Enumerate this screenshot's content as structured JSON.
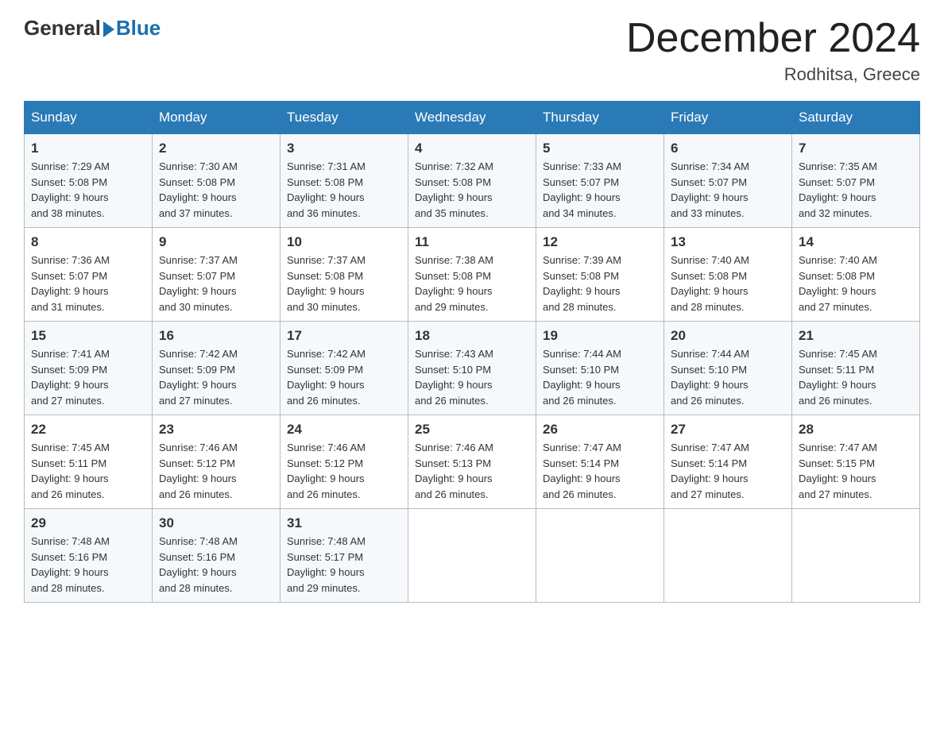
{
  "header": {
    "logo_general": "General",
    "logo_blue": "Blue",
    "title": "December 2024",
    "location": "Rodhitsa, Greece"
  },
  "days_of_week": [
    "Sunday",
    "Monday",
    "Tuesday",
    "Wednesday",
    "Thursday",
    "Friday",
    "Saturday"
  ],
  "weeks": [
    [
      {
        "day": "1",
        "sunrise": "7:29 AM",
        "sunset": "5:08 PM",
        "daylight": "9 hours and 38 minutes."
      },
      {
        "day": "2",
        "sunrise": "7:30 AM",
        "sunset": "5:08 PM",
        "daylight": "9 hours and 37 minutes."
      },
      {
        "day": "3",
        "sunrise": "7:31 AM",
        "sunset": "5:08 PM",
        "daylight": "9 hours and 36 minutes."
      },
      {
        "day": "4",
        "sunrise": "7:32 AM",
        "sunset": "5:08 PM",
        "daylight": "9 hours and 35 minutes."
      },
      {
        "day": "5",
        "sunrise": "7:33 AM",
        "sunset": "5:07 PM",
        "daylight": "9 hours and 34 minutes."
      },
      {
        "day": "6",
        "sunrise": "7:34 AM",
        "sunset": "5:07 PM",
        "daylight": "9 hours and 33 minutes."
      },
      {
        "day": "7",
        "sunrise": "7:35 AM",
        "sunset": "5:07 PM",
        "daylight": "9 hours and 32 minutes."
      }
    ],
    [
      {
        "day": "8",
        "sunrise": "7:36 AM",
        "sunset": "5:07 PM",
        "daylight": "9 hours and 31 minutes."
      },
      {
        "day": "9",
        "sunrise": "7:37 AM",
        "sunset": "5:07 PM",
        "daylight": "9 hours and 30 minutes."
      },
      {
        "day": "10",
        "sunrise": "7:37 AM",
        "sunset": "5:08 PM",
        "daylight": "9 hours and 30 minutes."
      },
      {
        "day": "11",
        "sunrise": "7:38 AM",
        "sunset": "5:08 PM",
        "daylight": "9 hours and 29 minutes."
      },
      {
        "day": "12",
        "sunrise": "7:39 AM",
        "sunset": "5:08 PM",
        "daylight": "9 hours and 28 minutes."
      },
      {
        "day": "13",
        "sunrise": "7:40 AM",
        "sunset": "5:08 PM",
        "daylight": "9 hours and 28 minutes."
      },
      {
        "day": "14",
        "sunrise": "7:40 AM",
        "sunset": "5:08 PM",
        "daylight": "9 hours and 27 minutes."
      }
    ],
    [
      {
        "day": "15",
        "sunrise": "7:41 AM",
        "sunset": "5:09 PM",
        "daylight": "9 hours and 27 minutes."
      },
      {
        "day": "16",
        "sunrise": "7:42 AM",
        "sunset": "5:09 PM",
        "daylight": "9 hours and 27 minutes."
      },
      {
        "day": "17",
        "sunrise": "7:42 AM",
        "sunset": "5:09 PM",
        "daylight": "9 hours and 26 minutes."
      },
      {
        "day": "18",
        "sunrise": "7:43 AM",
        "sunset": "5:10 PM",
        "daylight": "9 hours and 26 minutes."
      },
      {
        "day": "19",
        "sunrise": "7:44 AM",
        "sunset": "5:10 PM",
        "daylight": "9 hours and 26 minutes."
      },
      {
        "day": "20",
        "sunrise": "7:44 AM",
        "sunset": "5:10 PM",
        "daylight": "9 hours and 26 minutes."
      },
      {
        "day": "21",
        "sunrise": "7:45 AM",
        "sunset": "5:11 PM",
        "daylight": "9 hours and 26 minutes."
      }
    ],
    [
      {
        "day": "22",
        "sunrise": "7:45 AM",
        "sunset": "5:11 PM",
        "daylight": "9 hours and 26 minutes."
      },
      {
        "day": "23",
        "sunrise": "7:46 AM",
        "sunset": "5:12 PM",
        "daylight": "9 hours and 26 minutes."
      },
      {
        "day": "24",
        "sunrise": "7:46 AM",
        "sunset": "5:12 PM",
        "daylight": "9 hours and 26 minutes."
      },
      {
        "day": "25",
        "sunrise": "7:46 AM",
        "sunset": "5:13 PM",
        "daylight": "9 hours and 26 minutes."
      },
      {
        "day": "26",
        "sunrise": "7:47 AM",
        "sunset": "5:14 PM",
        "daylight": "9 hours and 26 minutes."
      },
      {
        "day": "27",
        "sunrise": "7:47 AM",
        "sunset": "5:14 PM",
        "daylight": "9 hours and 27 minutes."
      },
      {
        "day": "28",
        "sunrise": "7:47 AM",
        "sunset": "5:15 PM",
        "daylight": "9 hours and 27 minutes."
      }
    ],
    [
      {
        "day": "29",
        "sunrise": "7:48 AM",
        "sunset": "5:16 PM",
        "daylight": "9 hours and 28 minutes."
      },
      {
        "day": "30",
        "sunrise": "7:48 AM",
        "sunset": "5:16 PM",
        "daylight": "9 hours and 28 minutes."
      },
      {
        "day": "31",
        "sunrise": "7:48 AM",
        "sunset": "5:17 PM",
        "daylight": "9 hours and 29 minutes."
      },
      null,
      null,
      null,
      null
    ]
  ],
  "labels": {
    "sunrise": "Sunrise:",
    "sunset": "Sunset:",
    "daylight": "Daylight:"
  }
}
